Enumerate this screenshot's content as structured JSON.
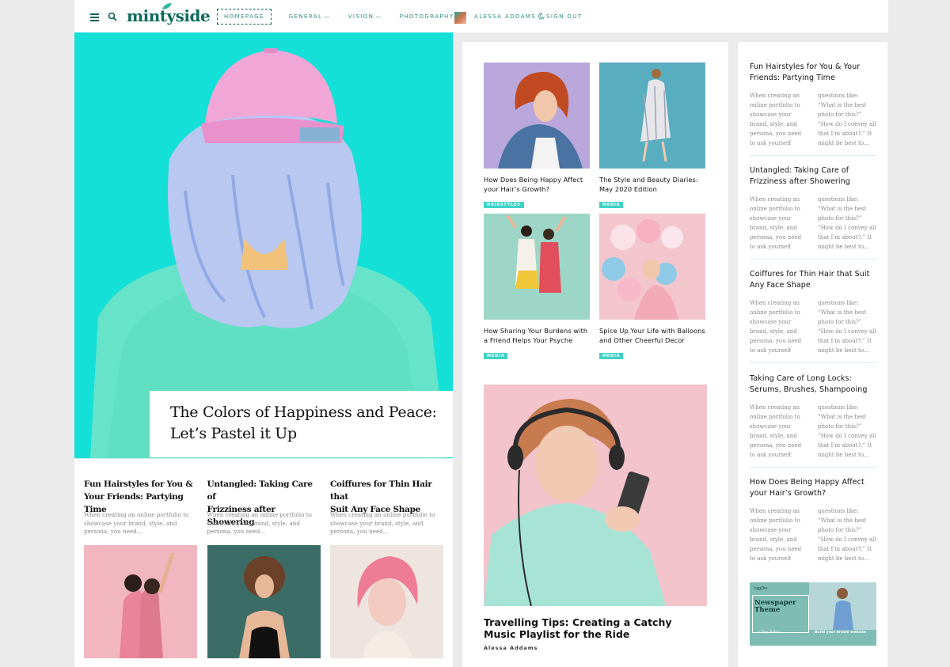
{
  "header": {
    "logo": "mintyside",
    "nav": [
      {
        "label": "HOMEPAGE",
        "active": true,
        "dropdown": false
      },
      {
        "label": "GENERAL",
        "active": false,
        "dropdown": true
      },
      {
        "label": "VISION",
        "active": false,
        "dropdown": true
      },
      {
        "label": "PHOTOGRAPHY",
        "active": false,
        "dropdown": true
      }
    ],
    "user_name": "ALESSA ADDAMS",
    "sign_out": "SIGN OUT",
    "dropdown_caret": "—"
  },
  "hero": {
    "title_line1": "The Colors of Happiness and Peace:",
    "title_line2": "Let’s Pastel it Up"
  },
  "mini_posts": [
    {
      "title_line1": "Fun Hairstyles for You &",
      "title_line2": "Your Friends: Partying Time",
      "excerpt": "When creating an online portfolio to showcase your brand, style, and persona, you need..."
    },
    {
      "title_line1": "Untangled: Taking Care of",
      "title_line2": "Frizziness after Showering",
      "excerpt": "When creating an online portfolio to showcase your brand, style, and persona, you need..."
    },
    {
      "title_line1": "Coiffures for Thin Hair that",
      "title_line2": "Suit Any Face Shape",
      "excerpt": "When creating an online portfolio to showcase your brand, style, and persona, you need..."
    }
  ],
  "grid_posts": [
    {
      "title": "How Does Being Happy Affect your Hair’s Growth?",
      "tag": "HAIRSTYLES"
    },
    {
      "title": "The Style and Beauty Diaries: May 2020 Edition",
      "tag": "MEDIA"
    },
    {
      "title": "How Sharing Your Burdens with a Friend Helps Your Psyche",
      "tag": "MEDIA"
    },
    {
      "title": "Spice Up Your Life with Balloons and Other Cheerful Decor",
      "tag": "MEDIA"
    }
  ],
  "featured": {
    "title": "Travelling Tips: Creating a Catchy Music Playlist for the Ride",
    "author": "Alessa Addams"
  },
  "side_posts": [
    {
      "title": "Fun Hairstyles for You & Your Friends: Partying Time"
    },
    {
      "title": "Untangled: Taking Care of Frizziness after Showering"
    },
    {
      "title": "Coiffures for Thin Hair that Suit Any Face Shape"
    },
    {
      "title": "Taking Care of Long Locks: Serums, Brushes, Shampooing"
    },
    {
      "title": "How Does Being Happy Affect your Hair’s Growth?"
    }
  ],
  "side_excerpt": {
    "col1": "When creating an online portfolio to showcase your brand, style, and persona, you need to ask yourself",
    "col2": "questions like: “What is the best photo for this?” “How do I convey all that I’m about?.” It might be best to..."
  },
  "ad": {
    "brand": "tagDiv",
    "title_line1": "Newspaper",
    "title_line2": "Theme",
    "buy": "— Buy Today",
    "cta": "Build your dream website"
  },
  "colors": {
    "brand": "#0d6a5c",
    "accent": "#2a8f82",
    "tag": "#3fd3c6",
    "hero_bg": "#14e0d8"
  }
}
